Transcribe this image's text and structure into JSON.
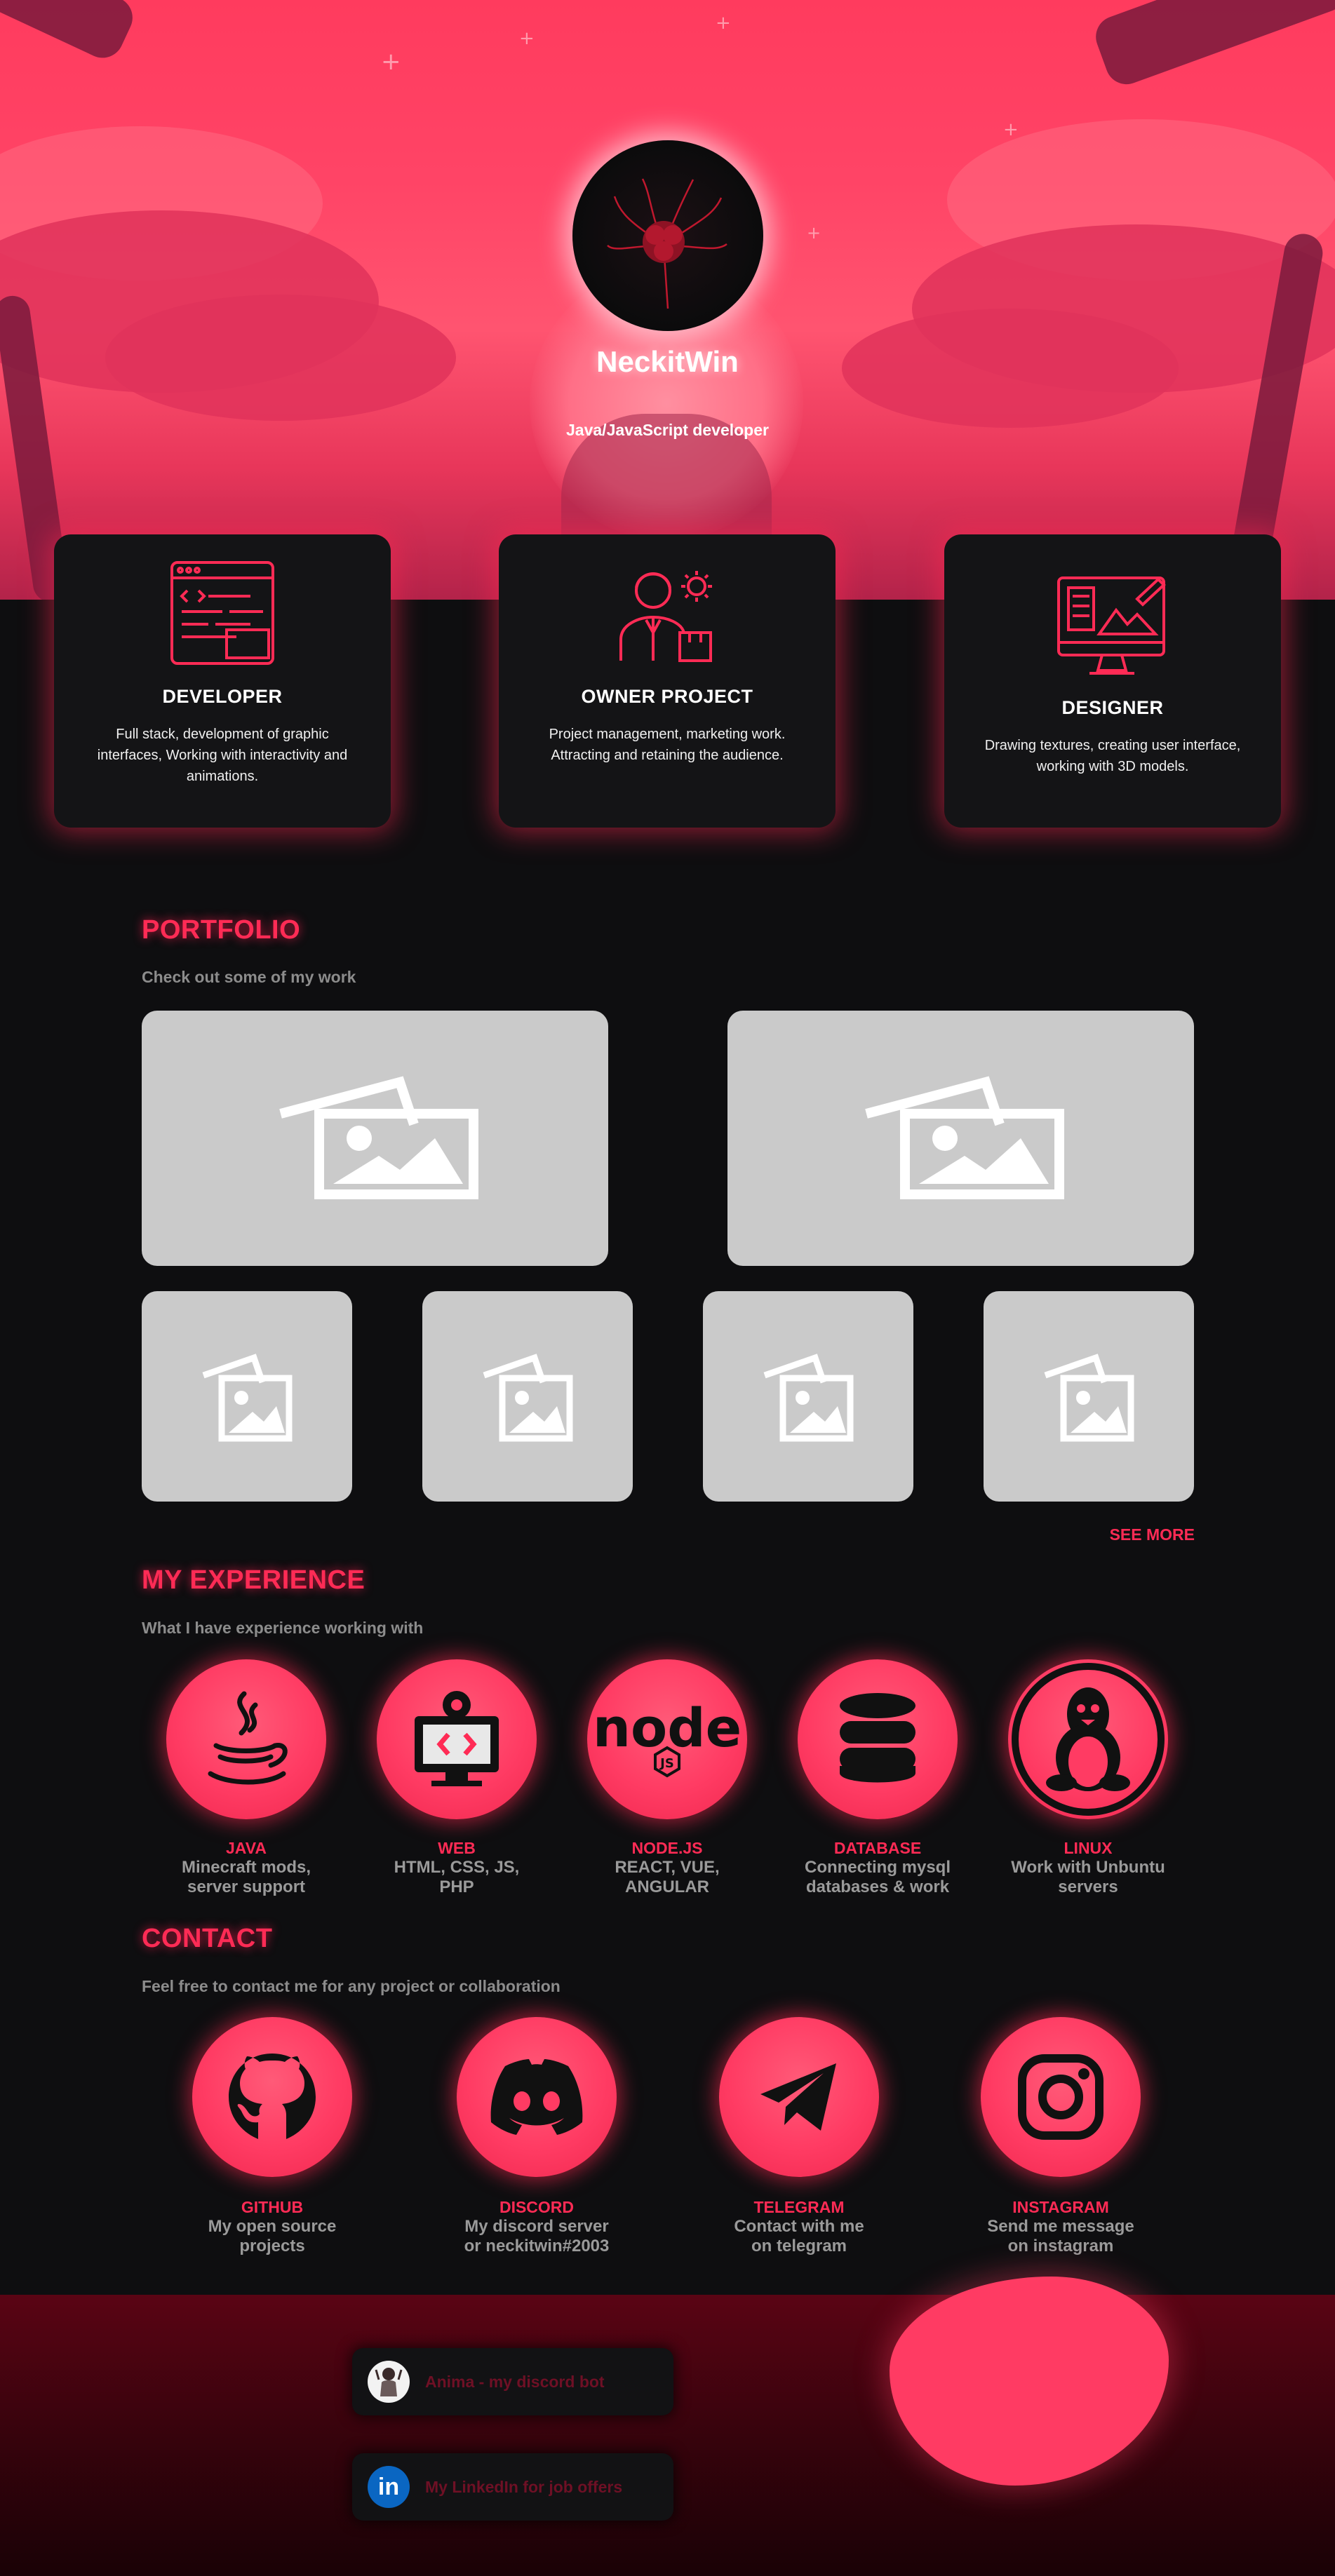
{
  "hero": {
    "name": "NeckitWin",
    "subtitle": "Java/JavaScript developer",
    "avatar_alt": "red spider lily avatar"
  },
  "cards": [
    {
      "icon": "code-window-icon",
      "title": "DEVELOPER",
      "desc": "Full stack, development of graphic interfaces, Working with interactivity and animations."
    },
    {
      "icon": "manager-gear-icon",
      "title": "OWNER PROJECT",
      "desc": "Project management, marketing work. Attracting and retaining the audience."
    },
    {
      "icon": "design-monitor-icon",
      "title": "DESIGNER",
      "desc": "Drawing textures, creating user interface, working with 3D models."
    }
  ],
  "portfolio": {
    "title": "PORTFOLIO",
    "subtitle": "Check out some of my work",
    "see_more": "SEE MORE"
  },
  "experience": {
    "title": "MY EXPERIENCE",
    "subtitle": "What I have experience working with",
    "items": [
      {
        "icon": "java-icon",
        "title": "JAVA",
        "line1": "Minecraft mods,",
        "line2": "server support"
      },
      {
        "icon": "web-icon",
        "title": "WEB",
        "line1": "HTML, CSS, JS,",
        "line2": "PHP"
      },
      {
        "icon": "nodejs-icon",
        "title": "NODE.JS",
        "line1": "REACT, VUE,",
        "line2": "ANGULAR"
      },
      {
        "icon": "database-icon",
        "title": "DATABASE",
        "line1": "Connecting mysql",
        "line2": "databases & work"
      },
      {
        "icon": "linux-icon",
        "title": "LINUX",
        "line1": "Work with Unbuntu",
        "line2": "servers"
      }
    ]
  },
  "contact": {
    "title": "CONTACT",
    "subtitle": "Feel free to contact me for any project or collaboration",
    "items": [
      {
        "icon": "github-icon",
        "title": "GITHUB",
        "line1": "My open source",
        "line2": "projects"
      },
      {
        "icon": "discord-icon",
        "title": "DISCORD",
        "line1": "My discord server",
        "line2": "or neckitwin#2003"
      },
      {
        "icon": "telegram-icon",
        "title": "TELEGRAM",
        "line1": "Contact with me",
        "line2": "on telegram"
      },
      {
        "icon": "instagram-icon",
        "title": "INSTAGRAM",
        "line1": "Send me message",
        "line2": "on instagram"
      }
    ]
  },
  "footer": {
    "buttons": [
      {
        "label": "Anima - my discord bot"
      },
      {
        "label": "My LinkedIn for job offers"
      }
    ]
  },
  "colors": {
    "accent": "#ff2b55",
    "bg": "#0e0e10",
    "card": "#141416",
    "tile": "#cacaca"
  }
}
